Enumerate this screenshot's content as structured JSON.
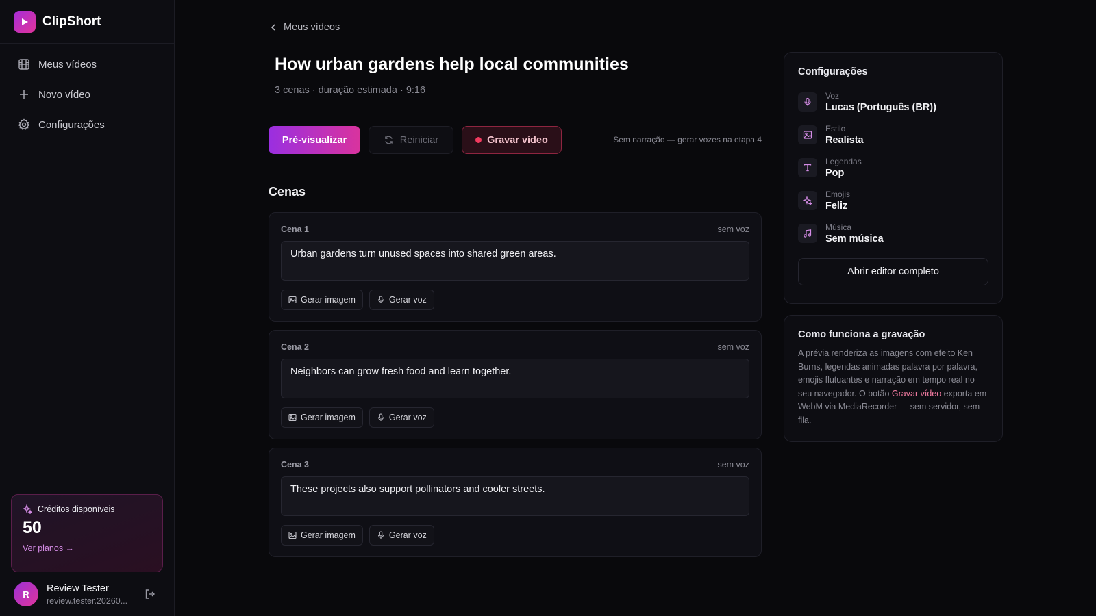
{
  "brand": {
    "name": "ClipShort"
  },
  "sidebar": {
    "items": [
      {
        "label": "Meus vídeos",
        "icon": "film-icon"
      },
      {
        "label": "Novo vídeo",
        "icon": "plus-icon"
      },
      {
        "label": "Configurações",
        "icon": "gear-icon"
      }
    ],
    "credits": {
      "title": "Créditos disponíveis",
      "value": "50",
      "link": "Ver planos →"
    },
    "user": {
      "initial": "R",
      "name": "Review Tester",
      "email": "review.tester.20260..."
    }
  },
  "main": {
    "back_label": "Meus vídeos",
    "title": "How urban gardens help local communities",
    "subtitle": "3 cenas · duração estimada · 9:16",
    "actions": {
      "preview": "Pré-visualizar",
      "restart": "Reiniciar",
      "record": "Gravar vídeo",
      "hint": "Sem narração — gerar vozes na etapa 4"
    },
    "scenes_title": "Cenas",
    "scenes": [
      {
        "label": "Cena 1",
        "status": "sem voz",
        "text": "Urban gardens turn unused spaces into shared green areas.",
        "image_btn": "Gerar imagem",
        "voice_btn": "Gerar voz"
      },
      {
        "label": "Cena 2",
        "status": "sem voz",
        "text": "Neighbors can grow fresh food and learn together.",
        "image_btn": "Gerar imagem",
        "voice_btn": "Gerar voz"
      },
      {
        "label": "Cena 3",
        "status": "sem voz",
        "text": "These projects also support pollinators and cooler streets.",
        "image_btn": "Gerar imagem",
        "voice_btn": "Gerar voz"
      }
    ]
  },
  "settings": {
    "title": "Configurações",
    "rows": [
      {
        "key": "Voz",
        "value": "Lucas (Português (BR))",
        "icon": "microphone-icon"
      },
      {
        "key": "Estilo",
        "value": "Realista",
        "icon": "image-icon"
      },
      {
        "key": "Legendas",
        "value": "Pop",
        "icon": "text-icon"
      },
      {
        "key": "Emojis",
        "value": "Feliz",
        "icon": "sparkle-icon"
      },
      {
        "key": "Música",
        "value": "Sem música",
        "icon": "music-icon"
      }
    ],
    "editor_button": "Abrir editor completo"
  },
  "howto": {
    "title": "Como funciona a gravação",
    "text_before": "A prévia renderiza as imagens com efeito Ken Burns, legendas animadas palavra por palavra, emojis flutuantes e narração em tempo real no seu navegador. O botão ",
    "highlight": "Gravar vídeo",
    "text_after": " exporta em WebM via MediaRecorder — sem servidor, sem fila."
  },
  "colors": {
    "accent": "#d9339e",
    "accent_purple": "#9a2fe0",
    "record_red": "#f03a5f",
    "background": "#09090c"
  }
}
